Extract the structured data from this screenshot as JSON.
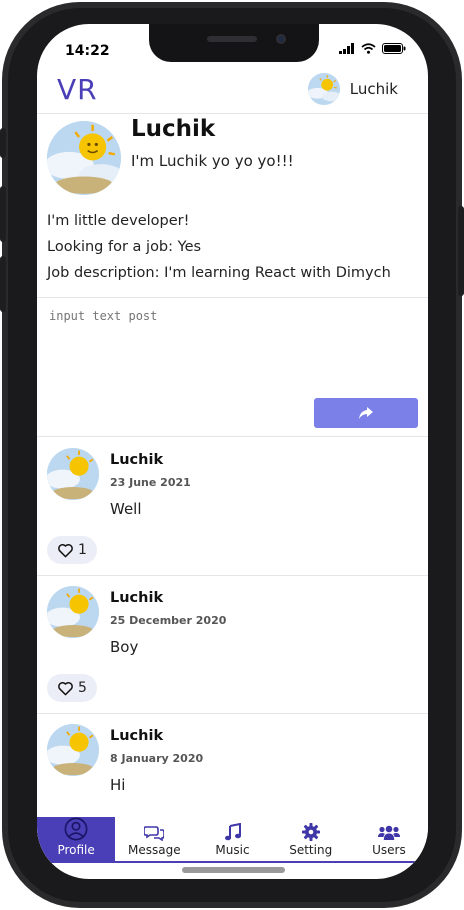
{
  "status": {
    "time": "14:22"
  },
  "header": {
    "logo": "VR",
    "user_name": "Luchik"
  },
  "profile": {
    "name": "Luchik",
    "status": "I'm Luchik yo yo yo!!!",
    "about": "I'm little developer!",
    "looking_for_job": "Looking for a job: Yes",
    "job_description": "Job description: I'm learning React with Dimych"
  },
  "new_post": {
    "placeholder": "input text post"
  },
  "posts": [
    {
      "author": "Luchik",
      "date": "23 June 2021",
      "text": "Well",
      "likes": "1"
    },
    {
      "author": "Luchik",
      "date": "25 December 2020",
      "text": "Boy",
      "likes": "5"
    },
    {
      "author": "Luchik",
      "date": "8 January 2020",
      "text": "Hi",
      "likes": ""
    }
  ],
  "nav": {
    "profile": "Profile",
    "message": "Message",
    "music": "Music",
    "setting": "Setting",
    "users": "Users"
  },
  "colors": {
    "accent": "#4a3fb7",
    "send_button": "#7b7fe8",
    "like_bg": "#ebeef6"
  }
}
